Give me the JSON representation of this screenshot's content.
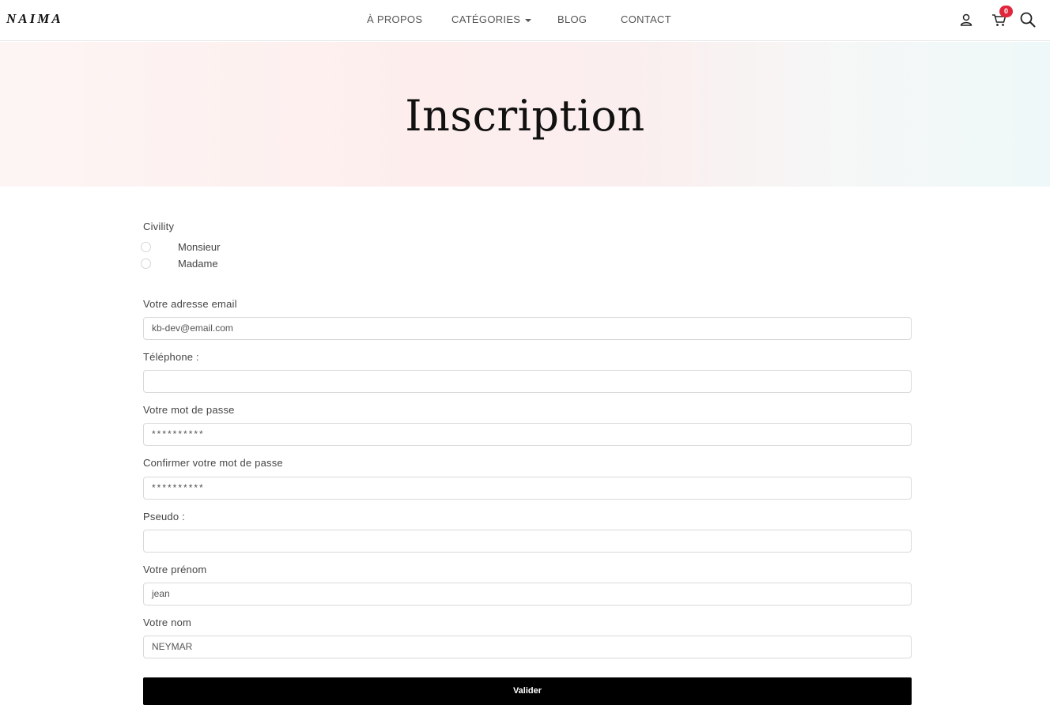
{
  "brand": {
    "logo": "NAIMA"
  },
  "nav": {
    "about": "À PROPOS",
    "categories": "CATÉGORIES",
    "blog": "BLOG",
    "contact": "CONTACT"
  },
  "icons": {
    "account": "user-icon",
    "cart": "cart-icon",
    "search": "search-icon"
  },
  "cart": {
    "count": "0"
  },
  "colors": {
    "badge": "#e0263d",
    "button": "#000000",
    "text": "#444444"
  },
  "page": {
    "title": "Inscription"
  },
  "form": {
    "civility": {
      "label": "Civility",
      "options": [
        "Monsieur",
        "Madame"
      ]
    },
    "email": {
      "label": "Votre adresse email",
      "value": "kb-dev@email.com"
    },
    "phone": {
      "label": "Téléphone :",
      "value": ""
    },
    "password": {
      "label": "Votre mot de passe",
      "value": "**********"
    },
    "confirm_password": {
      "label": "Confirmer votre mot de passe",
      "value": "**********"
    },
    "pseudo": {
      "label": "Pseudo :",
      "value": ""
    },
    "firstname": {
      "label": "Votre prénom",
      "value": "jean"
    },
    "lastname": {
      "label": "Votre nom",
      "value": "NEYMAR"
    },
    "submit_label": "Valider"
  }
}
